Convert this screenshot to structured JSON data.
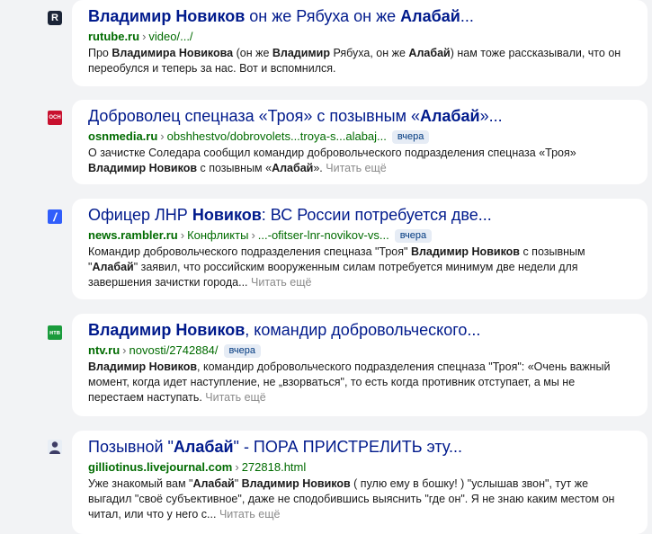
{
  "results": [
    {
      "favicon": "rutube-icon",
      "favicon_glyph": "R",
      "title_parts": [
        [
          "b",
          "Владимир Новиков"
        ],
        [
          "t",
          " он же Рябуха он же "
        ],
        [
          "b",
          "Алабай"
        ],
        [
          "t",
          "..."
        ]
      ],
      "host": "rutube.ru",
      "crumbs": [
        "video/.../"
      ],
      "badge": "",
      "snippet_parts": [
        [
          "t",
          "Про "
        ],
        [
          "b",
          "Владимира Новикова"
        ],
        [
          "t",
          " (он же "
        ],
        [
          "b",
          "Владимир"
        ],
        [
          "t",
          " Рябуха, он же "
        ],
        [
          "b",
          "Алабай"
        ],
        [
          "t",
          ") нам тоже рассказывали, что он переобулся и теперь за нас. Вот и вспомнился."
        ]
      ],
      "more": ""
    },
    {
      "favicon": "osn-media-icon",
      "favicon_glyph": "ОСН",
      "title_parts": [
        [
          "t",
          "Доброволец спецназа «Троя» с позывным «"
        ],
        [
          "b",
          "Алабай"
        ],
        [
          "t",
          "»..."
        ]
      ],
      "host": "osnmedia.ru",
      "crumbs": [
        "obshhestvo/dobrovolets...troya-s...alabaj..."
      ],
      "badge": "вчера",
      "snippet_parts": [
        [
          "t",
          "О зачистке Соледара сообщил командир добровольческого подразделения спецназа «Троя» "
        ],
        [
          "b",
          "Владимир Новиков"
        ],
        [
          "t",
          " с позывным «"
        ],
        [
          "b",
          "Алабай"
        ],
        [
          "t",
          "». "
        ]
      ],
      "more": "Читать ещё"
    },
    {
      "favicon": "rambler-icon",
      "favicon_glyph": "/",
      "title_parts": [
        [
          "t",
          "Офицер ЛНР "
        ],
        [
          "b",
          "Новиков"
        ],
        [
          "t",
          ": ВС России потребуется две..."
        ]
      ],
      "host": "news.rambler.ru",
      "crumbs": [
        "Конфликты",
        "...-ofitser-lnr-novikov-vs..."
      ],
      "badge": "вчера",
      "snippet_parts": [
        [
          "t",
          "Командир добровольческого подразделения спецназа \"Троя\" "
        ],
        [
          "b",
          "Владимир Новиков"
        ],
        [
          "t",
          " с позывным \""
        ],
        [
          "b",
          "Алабай"
        ],
        [
          "t",
          "\" заявил, что российским вооруженным силам потребуется минимум две недели для завершения зачистки города... "
        ]
      ],
      "more": "Читать ещё"
    },
    {
      "favicon": "ntv-icon",
      "favicon_glyph": "нтв",
      "title_parts": [
        [
          "b",
          "Владимир Новиков"
        ],
        [
          "t",
          ", командир добровольческого..."
        ]
      ],
      "host": "ntv.ru",
      "crumbs": [
        "novosti/2742884/"
      ],
      "badge": "вчера",
      "snippet_parts": [
        [
          "b",
          "Владимир Новиков"
        ],
        [
          "t",
          ", командир добровольческого подразделения спецназа \"Троя\": «Очень важный момент, когда идет наступление, не „взорваться\", то есть когда противник отступает, а мы не перестаем наступать. "
        ]
      ],
      "more": "Читать ещё"
    },
    {
      "favicon": "livejournal-user-icon",
      "favicon_glyph": "",
      "title_parts": [
        [
          "t",
          "Позывной \""
        ],
        [
          "b",
          "Алабай"
        ],
        [
          "t",
          "\" - ПОРА ПРИСТРЕЛИТЬ эту..."
        ]
      ],
      "host": "gilliotinus.livejournal.com",
      "crumbs": [
        "272818.html"
      ],
      "badge": "",
      "snippet_parts": [
        [
          "t",
          "Уже знакомый вам \""
        ],
        [
          "b",
          "Алабай"
        ],
        [
          "t",
          "\" "
        ],
        [
          "b",
          "Владимир Новиков"
        ],
        [
          "t",
          " ( пулю ему в бошку! ) \"услышав звон\", тут же выгадил \"своё субъективное\", даже не сподобившись выяснить \"где он\". Я не знаю каким местом он читал, или что у него с... "
        ]
      ],
      "more": "Читать ещё"
    }
  ],
  "colors": {
    "title": "#001a8c",
    "host": "#006b00",
    "badge_bg": "#e6ecf5",
    "more": "#8a8a8a",
    "page_bg": "#f2f3f5"
  }
}
